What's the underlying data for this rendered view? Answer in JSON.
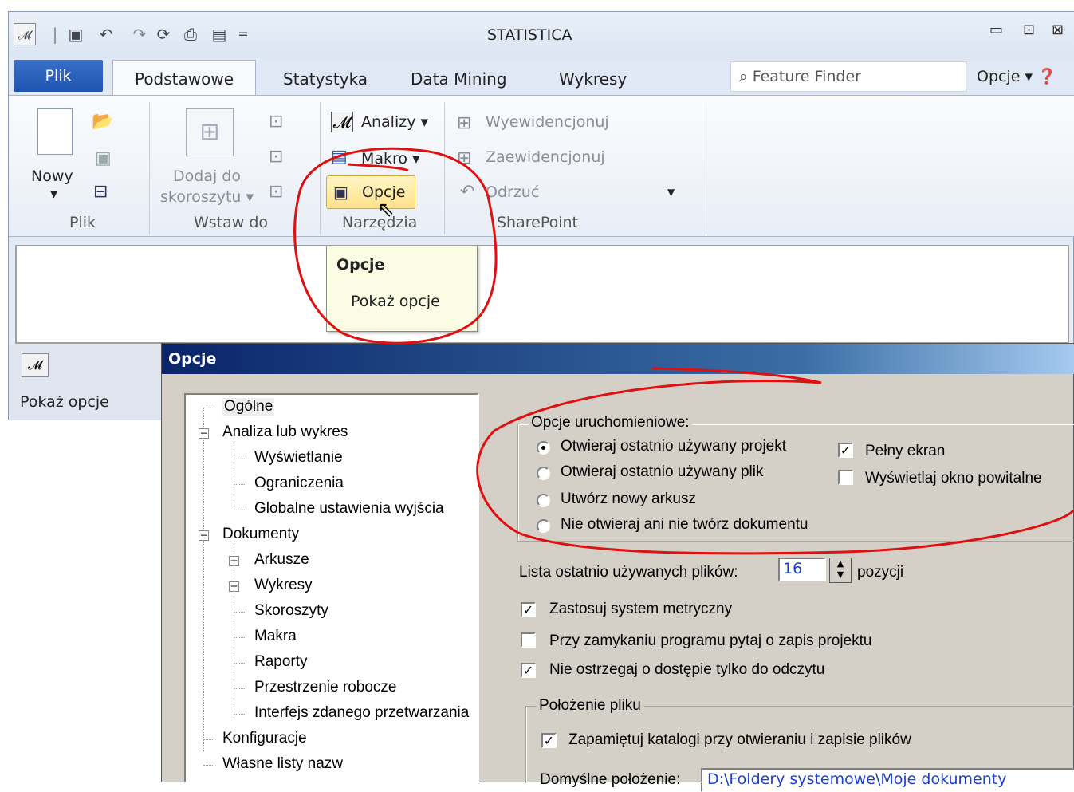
{
  "window": {
    "title": "STATISTICA",
    "min_glyph": "▭",
    "max_glyph": "⊡",
    "close_glyph": "⊠"
  },
  "quick_access": {
    "dropdown_glyph": "="
  },
  "tabs": {
    "file": "Plik",
    "items": [
      "Podstawowe",
      "Statystyka",
      "Data Mining",
      "Wykresy"
    ]
  },
  "feature_finder": {
    "placeholder": "Feature Finder"
  },
  "options_menu": {
    "label": "Opcje ▾"
  },
  "ribbon": {
    "plik_group": {
      "label": "Plik",
      "new": "Nowy"
    },
    "wstaw_group": {
      "label": "Wstaw do",
      "add_line1": "Dodaj do",
      "add_line2": "skoroszytu ▾"
    },
    "narzedzia_group": {
      "label": "Narzędzia",
      "analizy": "Analizy ▾",
      "makro": "Makro ▾",
      "opcje": "Opcje"
    },
    "sharepoint_group": {
      "label": "SharePoint",
      "checkin": "Wyewidencjonuj",
      "checkout": "Zaewidencjonuj",
      "discard": "Odrzuć"
    }
  },
  "tooltip": {
    "title": "Opcje",
    "description": "Pokaż opcje"
  },
  "statusbar": {
    "text": "Pokaż opcje"
  },
  "dialog": {
    "title": "Opcje",
    "tree": [
      {
        "label": "Ogólne",
        "selected": true
      },
      {
        "label": "Analiza lub wykres"
      },
      {
        "label": "Wyświetlanie"
      },
      {
        "label": "Ograniczenia"
      },
      {
        "label": "Globalne ustawienia wyjścia"
      },
      {
        "label": "Dokumenty"
      },
      {
        "label": "Arkusze"
      },
      {
        "label": "Wykresy"
      },
      {
        "label": "Skoroszyty"
      },
      {
        "label": "Makra"
      },
      {
        "label": "Raporty"
      },
      {
        "label": "Przestrzenie robocze"
      },
      {
        "label": "Interfejs zdanego przetwarzania"
      },
      {
        "label": "Konfiguracje"
      },
      {
        "label": "Własne listy nazw"
      }
    ],
    "startup_group": {
      "caption": "Opcje uruchomieniowe:",
      "radios": [
        {
          "label": "Otwieraj ostatnio używany projekt",
          "checked": true
        },
        {
          "label": "Otwieraj ostatnio używany plik",
          "checked": false
        },
        {
          "label": "Utwórz nowy arkusz",
          "checked": false
        },
        {
          "label": "Nie otwieraj ani nie twórz dokumentu",
          "checked": false
        }
      ],
      "fullscreen": {
        "label": "Pełny ekran",
        "checked": true
      },
      "splash": {
        "label": "Wyświetlaj okno powitalne",
        "checked": false
      }
    },
    "recent_files": {
      "label": "Lista ostatnio używanych plików:",
      "value": "16",
      "suffix": "pozycji"
    },
    "metric": {
      "label": "Zastosuj system metryczny",
      "checked": true
    },
    "ask_save": {
      "label": "Przy zamykaniu programu pytaj o zapis projektu",
      "checked": false
    },
    "readonly_warn": {
      "label": "Nie ostrzegaj o dostępie tylko do odczytu",
      "checked": true
    },
    "file_location": {
      "caption": "Położenie pliku",
      "remember": {
        "label": "Zapamiętuj katalogi przy otwieraniu i zapisie plików",
        "checked": true
      },
      "default_label": "Domyślne położenie:",
      "default_value": "D:\\Foldery systemowe\\Moje dokumenty"
    }
  },
  "colors": {
    "annotation": "#e01010",
    "dialog_bg": "#d4d0c8",
    "file_tab": "#2a5fbd"
  }
}
